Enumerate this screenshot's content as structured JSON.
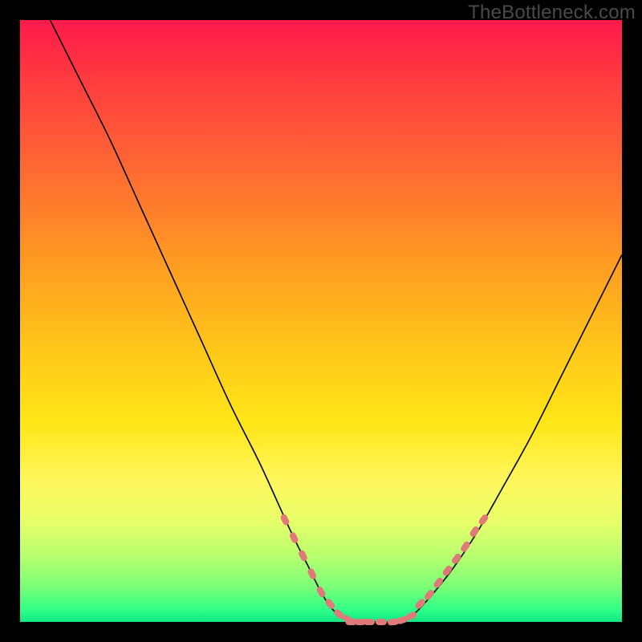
{
  "watermark": "TheBottleneck.com",
  "colors": {
    "curve_stroke": "#000000",
    "marker_fill": "#e07a7a",
    "marker_stroke": "#e07a7a"
  },
  "chart_data": {
    "type": "line",
    "title": "",
    "xlabel": "",
    "ylabel": "",
    "xlim": [
      0,
      100
    ],
    "ylim": [
      0,
      100
    ],
    "grid": false,
    "legend": false,
    "series": [
      {
        "name": "bottleneck-curve",
        "x": [
          5,
          10,
          15,
          20,
          25,
          30,
          35,
          40,
          45,
          48,
          50,
          52,
          55,
          58,
          60,
          62,
          65,
          68,
          72,
          76,
          80,
          85,
          90,
          95,
          100
        ],
        "y": [
          100,
          90,
          80,
          69,
          58,
          47,
          36,
          26,
          15,
          9,
          5,
          2,
          0,
          0,
          0,
          0,
          1,
          4,
          9,
          15,
          22,
          31,
          41,
          51,
          61
        ]
      }
    ],
    "markers": {
      "left_branch": {
        "x": [
          44,
          45.5,
          47,
          48.5,
          50,
          51.5,
          53,
          54.5
        ],
        "y": [
          17,
          14,
          11,
          8,
          5,
          3,
          1.3,
          0.4
        ]
      },
      "valley_floor": {
        "x": [
          55,
          56.5,
          58,
          60,
          62,
          63.5,
          65
        ],
        "y": [
          0,
          0,
          0,
          0,
          0,
          0.3,
          1
        ]
      },
      "right_branch": {
        "x": [
          66.5,
          68,
          69.5,
          71,
          72.5,
          74,
          75.5,
          77
        ],
        "y": [
          3,
          4.5,
          6.5,
          8.5,
          10.5,
          12.5,
          15,
          17
        ]
      }
    }
  }
}
